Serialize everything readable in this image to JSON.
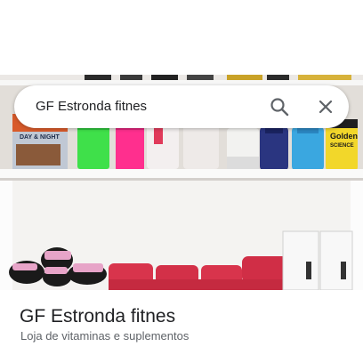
{
  "search": {
    "query": "GF Estronda fitnes",
    "search_icon": "search-icon",
    "close_icon": "close-icon"
  },
  "product_labels": {
    "box_brand": "DAY & NIGHT",
    "bottle_brand_line1": "Golden",
    "bottle_brand_line2": "SCIENCE"
  },
  "place": {
    "name": "GF Estronda fitnes",
    "category": "Loja de vitaminas e suplementos"
  },
  "colors": {
    "search_bg": "#ffffff",
    "query_text": "#202124",
    "icon": "#5f6368",
    "title_text": "#202124",
    "subtitle_text": "#5f6368"
  }
}
